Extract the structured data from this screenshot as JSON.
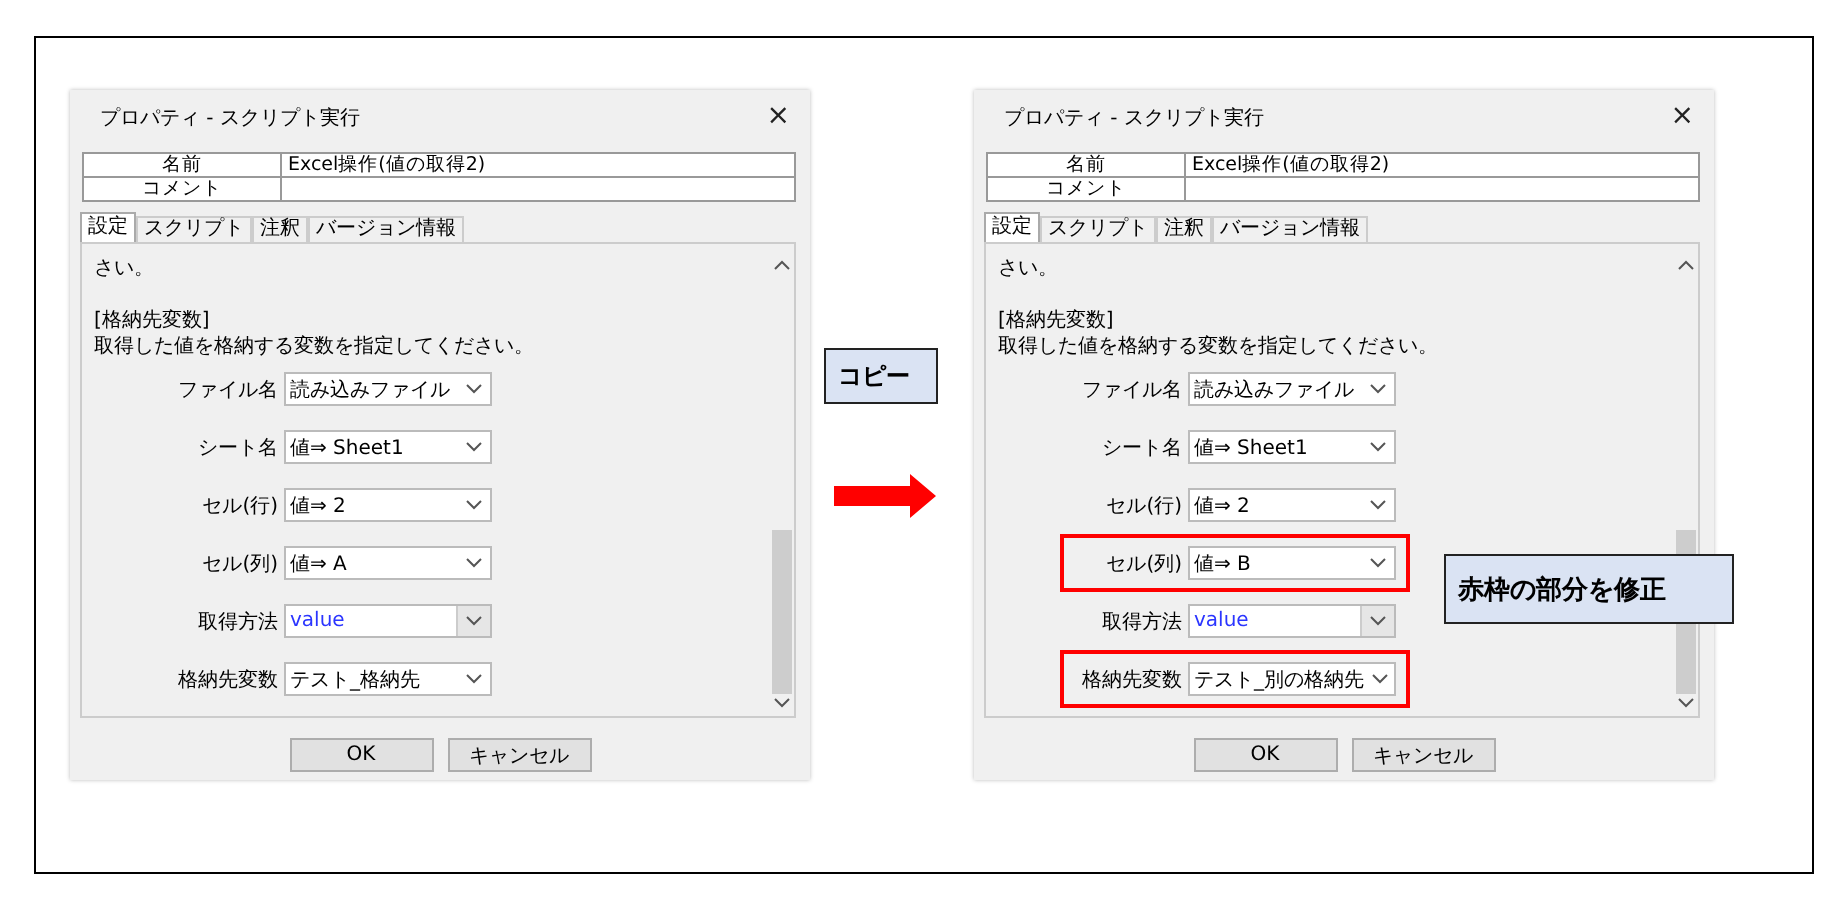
{
  "dialogs": [
    {
      "title": "プロパティ - スクリプト実行",
      "close": "×",
      "properties": [
        {
          "label": "名前",
          "value": "Excel操作(値の取得2)"
        },
        {
          "label": "コメント"
        }
      ],
      "tabs": [
        {
          "label": "設定",
          "selected": true
        },
        {
          "label": "スクリプト",
          "selected": false
        },
        {
          "label": "注釈",
          "selected": false
        },
        {
          "label": "バージョン情報",
          "selected": false
        }
      ],
      "description_paragraphs": [
        [
          "さい。"
        ],
        [
          "[格納先変数]",
          "取得した値を格納する変数を指定してください。"
        ]
      ],
      "fields": [
        {
          "label": "ファイル名",
          "value": "読み込みファイル",
          "kind": "combo",
          "highlighted": false
        },
        {
          "label": "シート名",
          "value": "値⇒ Sheet1",
          "kind": "combo",
          "highlighted": false
        },
        {
          "label": "セル(行)",
          "value": "値⇒ 2",
          "kind": "combo",
          "highlighted": false
        },
        {
          "label": "セル(列)",
          "value": "値⇒ A",
          "kind": "combo",
          "highlighted": false
        },
        {
          "label": "取得方法",
          "value": "value",
          "kind": "list",
          "highlighted": false
        },
        {
          "label": "格納先変数",
          "value": "テスト_格納先",
          "kind": "combo",
          "highlighted": false
        }
      ],
      "buttons": [
        "OK",
        "キャンセル"
      ]
    },
    {
      "title": "プロパティ - スクリプト実行",
      "close": "×",
      "properties": [
        {
          "label": "名前",
          "value": "Excel操作(値の取得2)"
        },
        {
          "label": "コメント"
        }
      ],
      "tabs": [
        {
          "label": "設定",
          "selected": true
        },
        {
          "label": "スクリプト",
          "selected": false
        },
        {
          "label": "注釈",
          "selected": false
        },
        {
          "label": "バージョン情報",
          "selected": false
        }
      ],
      "description_paragraphs": [
        [
          "さい。"
        ],
        [
          "[格納先変数]",
          "取得した値を格納する変数を指定してください。"
        ]
      ],
      "fields": [
        {
          "label": "ファイル名",
          "value": "読み込みファイル",
          "kind": "combo",
          "highlighted": false
        },
        {
          "label": "シート名",
          "value": "値⇒ Sheet1",
          "kind": "combo",
          "highlighted": false
        },
        {
          "label": "セル(行)",
          "value": "値⇒ 2",
          "kind": "combo",
          "highlighted": false
        },
        {
          "label": "セル(列)",
          "value": "値⇒ B",
          "kind": "combo",
          "highlighted": true
        },
        {
          "label": "取得方法",
          "value": "value",
          "kind": "list",
          "highlighted": false
        },
        {
          "label": "格納先変数",
          "value": "テスト_別の格納先",
          "kind": "combo",
          "highlighted": true
        }
      ],
      "buttons": [
        "OK",
        "キャンセル"
      ]
    }
  ],
  "copy_note": "コピー",
  "fix_note": "赤枠の部分を修正"
}
